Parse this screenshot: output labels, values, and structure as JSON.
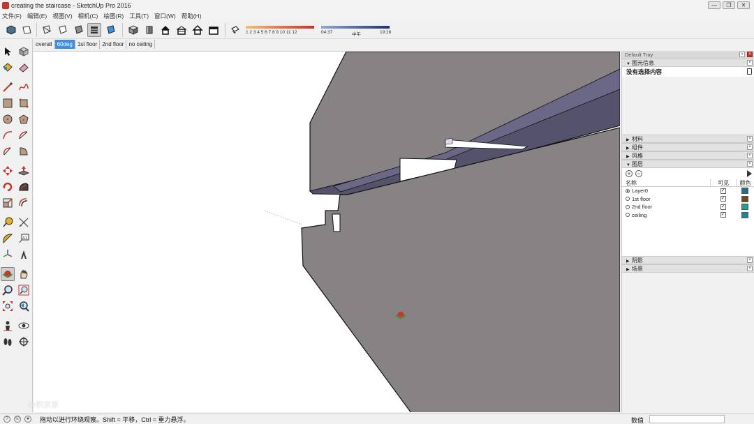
{
  "window": {
    "title": "creating the staircase - SketchUp Pro 2016",
    "minimize": "—",
    "restore": "❐",
    "close": "✕"
  },
  "menu": [
    {
      "label": "文件(F)"
    },
    {
      "label": "编辑(E)"
    },
    {
      "label": "视图(V)"
    },
    {
      "label": "相机(C)"
    },
    {
      "label": "绘图(R)"
    },
    {
      "label": "工具(T)"
    },
    {
      "label": "窗口(W)"
    },
    {
      "label": "帮助(H)"
    }
  ],
  "toolbar": {
    "buttons": [
      {
        "name": "iso-view-icon"
      },
      {
        "name": "top-view-icon"
      },
      {
        "name": "xray-style-icon"
      },
      {
        "name": "wireframe-style-icon"
      },
      {
        "name": "shaded-style-icon"
      },
      {
        "name": "hidden-line-style-icon"
      },
      {
        "name": "textured-style-icon"
      },
      {
        "name": "components-icon"
      },
      {
        "name": "front-view-icon"
      },
      {
        "name": "home-icon"
      },
      {
        "name": "right-view-icon"
      },
      {
        "name": "back-view-icon"
      },
      {
        "name": "left-view-icon"
      },
      {
        "name": "shadows-toggle-icon"
      }
    ],
    "month_ticks": "1 2 3 4 5 6 7 8 9 10 11 12",
    "time_start": "04:37",
    "time_mid": "中午",
    "time_end": "19:28",
    "colors": {
      "month_bar_from": "#f3c06b",
      "month_bar_to": "#d62b2b",
      "time_bar_from": "#8fa9d6",
      "time_bar_to": "#1f2f7a"
    }
  },
  "scenes": [
    {
      "label": "overall",
      "active": false
    },
    {
      "label": "60deg",
      "active": true
    },
    {
      "label": "1st floor",
      "active": false
    },
    {
      "label": "2nd floor",
      "active": false
    },
    {
      "label": "no ceiling",
      "active": false
    }
  ],
  "tools": [
    {
      "name": "select-icon"
    },
    {
      "name": "make-component-icon"
    },
    {
      "name": "paint-bucket-icon"
    },
    {
      "name": "eraser-icon"
    },
    {
      "name": "line-icon"
    },
    {
      "name": "freehand-icon"
    },
    {
      "name": "rectangle-icon"
    },
    {
      "name": "rotated-rectangle-icon"
    },
    {
      "name": "circle-icon"
    },
    {
      "name": "polygon-icon"
    },
    {
      "name": "arc-icon"
    },
    {
      "name": "two-point-arc-icon"
    },
    {
      "name": "three-point-arc-icon"
    },
    {
      "name": "pie-icon"
    },
    {
      "name": "move-icon"
    },
    {
      "name": "push-pull-icon"
    },
    {
      "name": "rotate-icon"
    },
    {
      "name": "follow-me-icon"
    },
    {
      "name": "scale-icon"
    },
    {
      "name": "offset-icon"
    },
    {
      "name": "tape-measure-icon"
    },
    {
      "name": "dimension-icon"
    },
    {
      "name": "protractor-icon"
    },
    {
      "name": "text-icon"
    },
    {
      "name": "axes-icon"
    },
    {
      "name": "3d-text-icon"
    },
    {
      "name": "orbit-icon"
    },
    {
      "name": "pan-icon"
    },
    {
      "name": "zoom-icon"
    },
    {
      "name": "zoom-window-icon"
    },
    {
      "name": "zoom-extents-icon"
    },
    {
      "name": "previous-view-icon"
    },
    {
      "name": "position-camera-icon"
    },
    {
      "name": "look-around-icon"
    },
    {
      "name": "walk-icon"
    },
    {
      "name": "section-plane-icon"
    }
  ],
  "tray": {
    "title": "Default Tray",
    "entity_info": {
      "header": "图元信息",
      "content": "没有选择内容"
    },
    "panels_top": [
      {
        "label": "材料"
      },
      {
        "label": "组件"
      },
      {
        "label": "风格"
      }
    ],
    "layers": {
      "header": "图层",
      "col_name": "名称",
      "col_visible": "可见",
      "col_color": "颜色",
      "add_label": "+",
      "remove_label": "−",
      "rows": [
        {
          "name": "Layer0",
          "active": true,
          "visible": true,
          "color": "#1f6f8f"
        },
        {
          "name": "1st floor",
          "active": false,
          "visible": true,
          "color": "#6b4a1c"
        },
        {
          "name": "2nd floor",
          "active": false,
          "visible": true,
          "color": "#1fa08f"
        },
        {
          "name": "ceiling",
          "active": false,
          "visible": true,
          "color": "#1a8a9a"
        }
      ]
    },
    "panels_bottom": [
      {
        "label": "阴影"
      },
      {
        "label": "场景"
      }
    ]
  },
  "viewport": {
    "watermark": "@积京京",
    "model_face_color": "#878284",
    "model_dark_color": "#55526b",
    "model_mid_color": "#6b6787"
  },
  "statusbar": {
    "hint": "拖动以进行环绕观察。Shift = 平移，Ctrl = 重力悬浮。",
    "measure_label": "数值",
    "measure_value": ""
  }
}
